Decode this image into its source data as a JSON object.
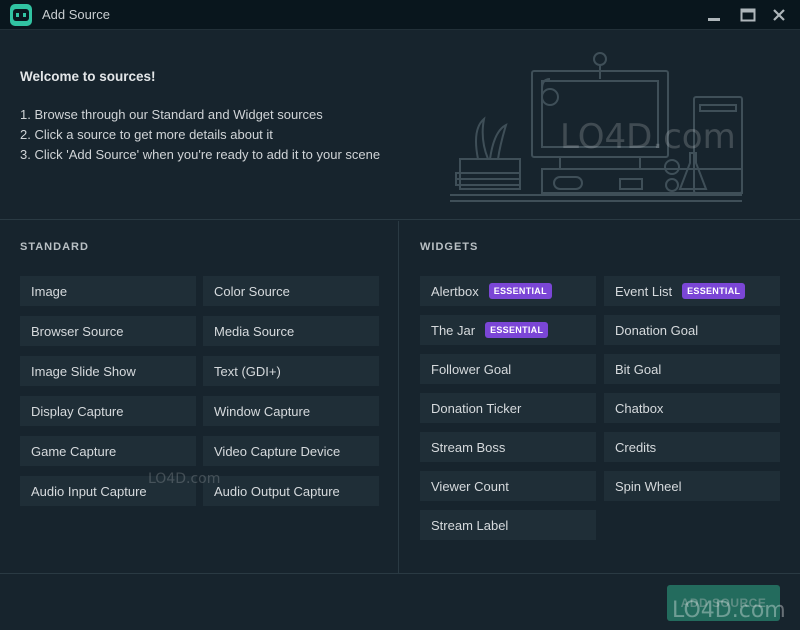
{
  "window": {
    "title": "Add Source",
    "controls": [
      "minimize-icon",
      "maximize-icon",
      "close-icon"
    ]
  },
  "welcome": {
    "title": "Welcome to sources!",
    "steps": [
      "1. Browse through our Standard and Widget sources",
      "2. Click a source to get more details about it",
      "3. Click 'Add Source' when you're ready to add it to your scene"
    ]
  },
  "standard": {
    "header": "STANDARD",
    "items": [
      "Image",
      "Color Source",
      "Browser Source",
      "Media Source",
      "Image Slide Show",
      "Text (GDI+)",
      "Display Capture",
      "Window Capture",
      "Game Capture",
      "Video Capture Device",
      "Audio Input Capture",
      "Audio Output Capture"
    ]
  },
  "widgets": {
    "header": "WIDGETS",
    "badge_label": "ESSENTIAL",
    "items": [
      {
        "label": "Alertbox",
        "essential": true
      },
      {
        "label": "Event List",
        "essential": true
      },
      {
        "label": "The Jar",
        "essential": true
      },
      {
        "label": "Donation Goal",
        "essential": false
      },
      {
        "label": "Follower Goal",
        "essential": false
      },
      {
        "label": "Bit Goal",
        "essential": false
      },
      {
        "label": "Donation Ticker",
        "essential": false
      },
      {
        "label": "Chatbox",
        "essential": false
      },
      {
        "label": "Stream Boss",
        "essential": false
      },
      {
        "label": "Credits",
        "essential": false
      },
      {
        "label": "Viewer Count",
        "essential": false
      },
      {
        "label": "Spin Wheel",
        "essential": false
      },
      {
        "label": "Stream Label",
        "essential": false
      }
    ]
  },
  "footer": {
    "add_source_label": "ADD SOURCE"
  },
  "watermark": {
    "text": "LO4D.com"
  },
  "colors": {
    "accent": "#31c3a2",
    "badge": "#7b46d6",
    "background": "#17242d",
    "item": "#1f2e37"
  }
}
